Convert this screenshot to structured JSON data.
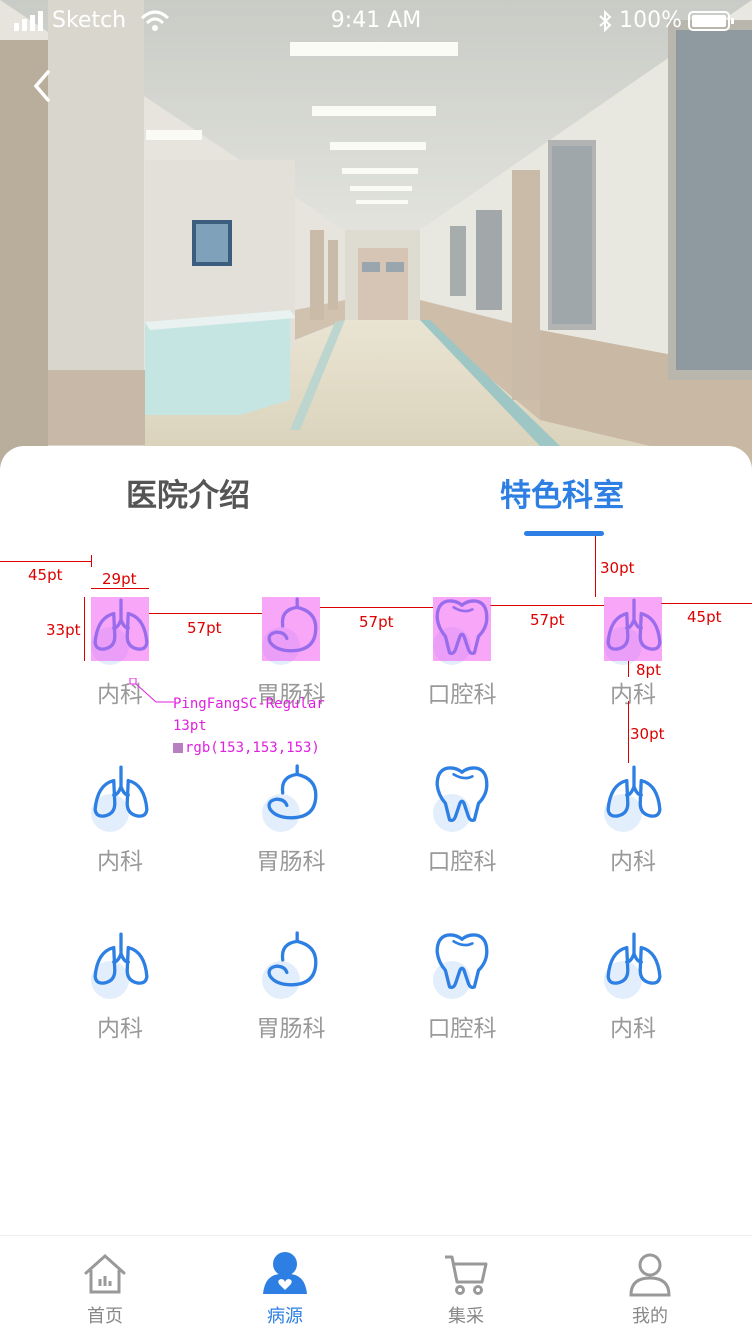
{
  "status": {
    "carrier": "Sketch",
    "time": "9:41 AM",
    "battery": "100%"
  },
  "tabs": [
    {
      "label": "医院介绍"
    },
    {
      "label": "特色科室"
    }
  ],
  "departments": [
    {
      "label": "内科",
      "icon": "lungs-icon"
    },
    {
      "label": "胃肠科",
      "icon": "stomach-icon"
    },
    {
      "label": "口腔科",
      "icon": "tooth-icon"
    },
    {
      "label": "内科",
      "icon": "lungs-icon"
    },
    {
      "label": "内科",
      "icon": "lungs-icon"
    },
    {
      "label": "胃肠科",
      "icon": "stomach-icon"
    },
    {
      "label": "口腔科",
      "icon": "tooth-icon"
    },
    {
      "label": "内科",
      "icon": "lungs-icon"
    },
    {
      "label": "内科",
      "icon": "lungs-icon"
    },
    {
      "label": "胃肠科",
      "icon": "stomach-icon"
    },
    {
      "label": "口腔科",
      "icon": "tooth-icon"
    },
    {
      "label": "内科",
      "icon": "lungs-icon"
    }
  ],
  "annotations": {
    "m_left": "45pt",
    "m_width": "29pt",
    "m_height": "33pt",
    "m_gap1": "57pt",
    "m_gap2": "57pt",
    "m_gap3": "57pt",
    "m_right": "45pt",
    "m_top": "30pt",
    "m_label_gap": "8pt",
    "m_row_gap": "30pt",
    "font": "PingFangSC-Regular",
    "size": "13pt",
    "color": "rgb(153,153,153)"
  },
  "tabbar": [
    {
      "label": "首页",
      "icon": "home-icon"
    },
    {
      "label": "病源",
      "icon": "patient-icon"
    },
    {
      "label": "集采",
      "icon": "cart-icon"
    },
    {
      "label": "我的",
      "icon": "user-icon"
    }
  ],
  "colors": {
    "accent": "#2d7fe3",
    "label": "#999999",
    "annotation": "#dd0000",
    "highlight": "#f35cf3"
  }
}
